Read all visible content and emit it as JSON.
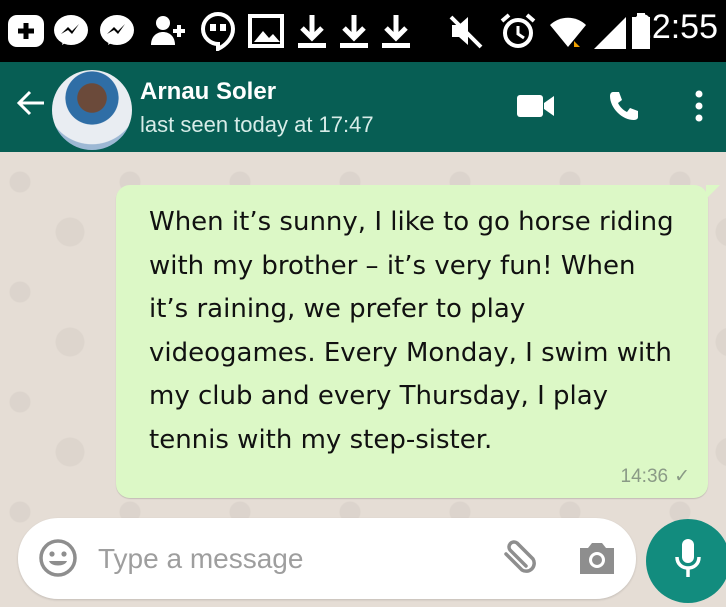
{
  "status_bar": {
    "time": "22:55",
    "icons": [
      "plus-box-icon",
      "messenger-icon",
      "messenger-icon",
      "add-contact-icon",
      "hangouts-icon",
      "image-icon",
      "download-icon",
      "download-icon",
      "download-icon",
      "mute-icon",
      "alarm-icon",
      "wifi-icon",
      "signal-icon",
      "battery-icon"
    ]
  },
  "header": {
    "contact_name": "Arnau Soler",
    "last_seen": "last seen today at 17:47"
  },
  "message": {
    "lines": [
      "When it’s sunny, I like to go horse riding",
      "with my brother – it’s very fun! When",
      "it’s raining, we prefer to play",
      "videogames. Every Monday, I swim with",
      "my club and every Thursday, I play",
      "tennis with my step-sister."
    ],
    "time": "14:36",
    "status": "✓"
  },
  "input": {
    "placeholder": "Type a message"
  },
  "colors": {
    "header": "#075e54",
    "bubble": "#dcf8c6",
    "mic_button": "#128c7e",
    "chat_bg": "#e5ddd5"
  }
}
